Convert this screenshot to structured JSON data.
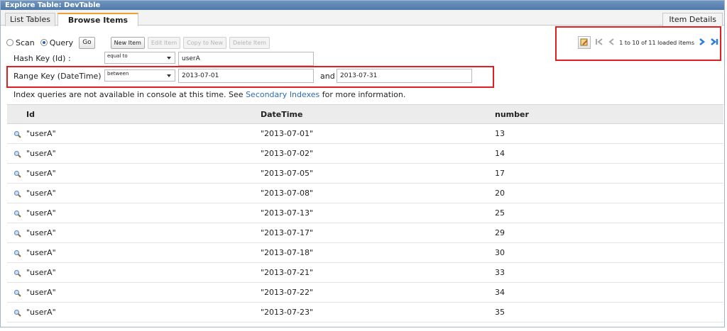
{
  "window": {
    "title": "Explore Table: DevTable"
  },
  "tabs": [
    {
      "label": "List Tables",
      "active": false
    },
    {
      "label": "Browse Items",
      "active": true
    }
  ],
  "item_details_label": "Item Details",
  "mode": {
    "scan_label": "Scan",
    "query_label": "Query",
    "selected": "Query",
    "go_label": "Go"
  },
  "toolbar": {
    "new_item": "New Item",
    "edit_item": "Edit Item",
    "copy_to_new": "Copy to New",
    "delete_item": "Delete Item"
  },
  "hash_key": {
    "label": "Hash Key (Id) :",
    "operator": "equal to",
    "value": "userA"
  },
  "range_key": {
    "label": "Range Key (DateTime) :",
    "operator": "between",
    "value_from": "2013-07-01",
    "and_label": "and",
    "value_to": "2013-07-31"
  },
  "info": {
    "text_before": "Index queries are not available in console at this time. See ",
    "link": "Secondary Indexes",
    "text_after": " for more information."
  },
  "pager": {
    "text": "1 to 10 of 11 loaded items"
  },
  "accent_colors": {
    "highlight": "#e02020",
    "title_bar": "#5a82b0",
    "link": "#2b6cb0"
  },
  "table": {
    "columns": [
      "Id",
      "DateTime",
      "number"
    ],
    "rows": [
      [
        "\"userA\"",
        "\"2013-07-01\"",
        "13"
      ],
      [
        "\"userA\"",
        "\"2013-07-02\"",
        "14"
      ],
      [
        "\"userA\"",
        "\"2013-07-05\"",
        "17"
      ],
      [
        "\"userA\"",
        "\"2013-07-08\"",
        "20"
      ],
      [
        "\"userA\"",
        "\"2013-07-13\"",
        "25"
      ],
      [
        "\"userA\"",
        "\"2013-07-17\"",
        "29"
      ],
      [
        "\"userA\"",
        "\"2013-07-18\"",
        "30"
      ],
      [
        "\"userA\"",
        "\"2013-07-21\"",
        "33"
      ],
      [
        "\"userA\"",
        "\"2013-07-22\"",
        "34"
      ],
      [
        "\"userA\"",
        "\"2013-07-23\"",
        "35"
      ]
    ]
  }
}
